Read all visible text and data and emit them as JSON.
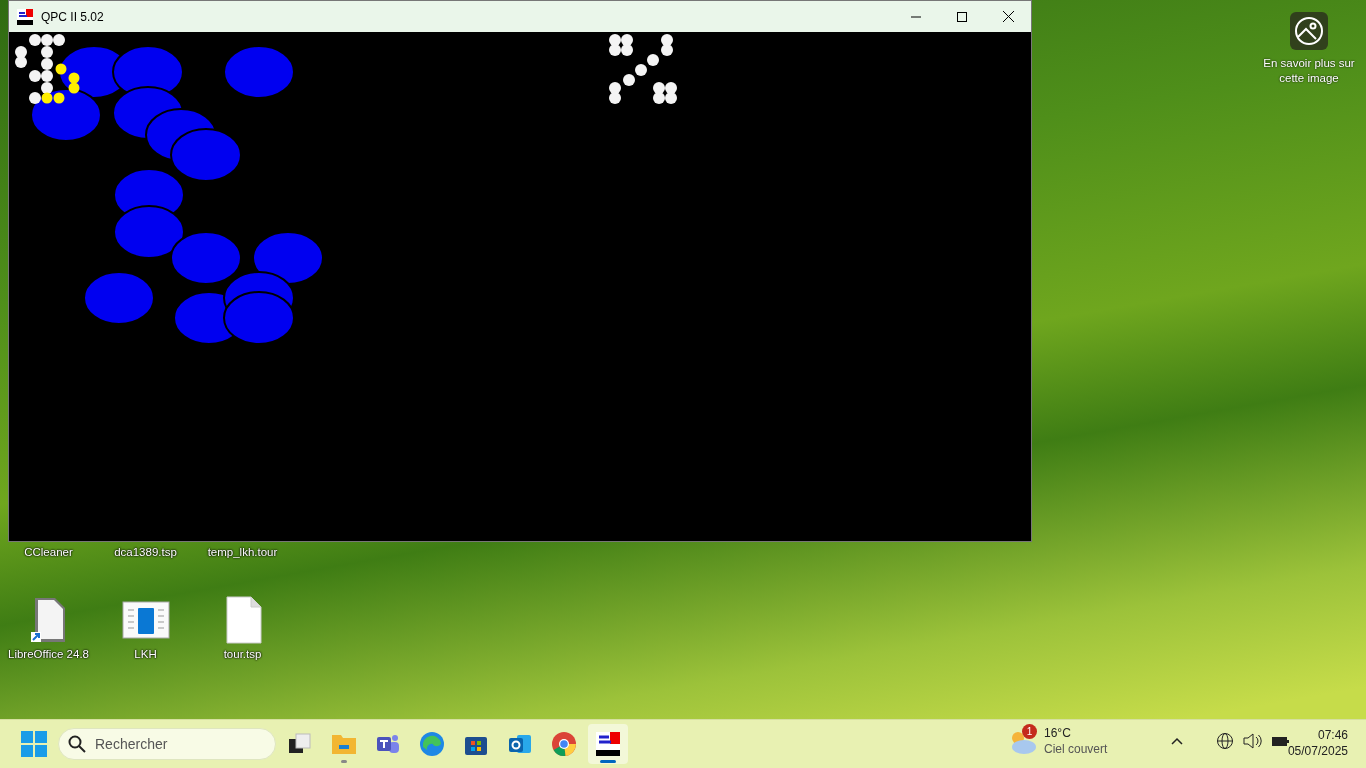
{
  "window": {
    "title": "QPC II 5.02"
  },
  "spotlight": {
    "label": "En savoir plus sur cette image"
  },
  "desktop_icons": [
    {
      "label": "CCleaner",
      "kind": "covered"
    },
    {
      "label": "dca1389.tsp",
      "kind": "covered"
    },
    {
      "label": "temp_lkh.tour",
      "kind": "covered"
    },
    {
      "label": "LibreOffice 24.8",
      "kind": "shortcut"
    },
    {
      "label": "LKH",
      "kind": "app"
    },
    {
      "label": "tour.tsp",
      "kind": "file"
    }
  ],
  "taskbar": {
    "search": {
      "placeholder": "Rechercher"
    },
    "apps": [
      {
        "kind": "taskview",
        "selected": false,
        "running": false
      },
      {
        "kind": "folder",
        "selected": false,
        "running": true
      },
      {
        "kind": "teams",
        "selected": false,
        "running": false
      },
      {
        "kind": "edge",
        "selected": false,
        "running": false
      },
      {
        "kind": "store",
        "selected": false,
        "running": false
      },
      {
        "kind": "outlook",
        "selected": false,
        "running": false
      },
      {
        "kind": "chrome",
        "selected": false,
        "running": false
      },
      {
        "kind": "qpc",
        "selected": true,
        "running": true
      }
    ],
    "weather": {
      "badge": "1",
      "temperature": "16°C",
      "condition": "Ciel couvert"
    },
    "clock": {
      "time": "07:46",
      "date": "05/07/2025"
    }
  }
}
